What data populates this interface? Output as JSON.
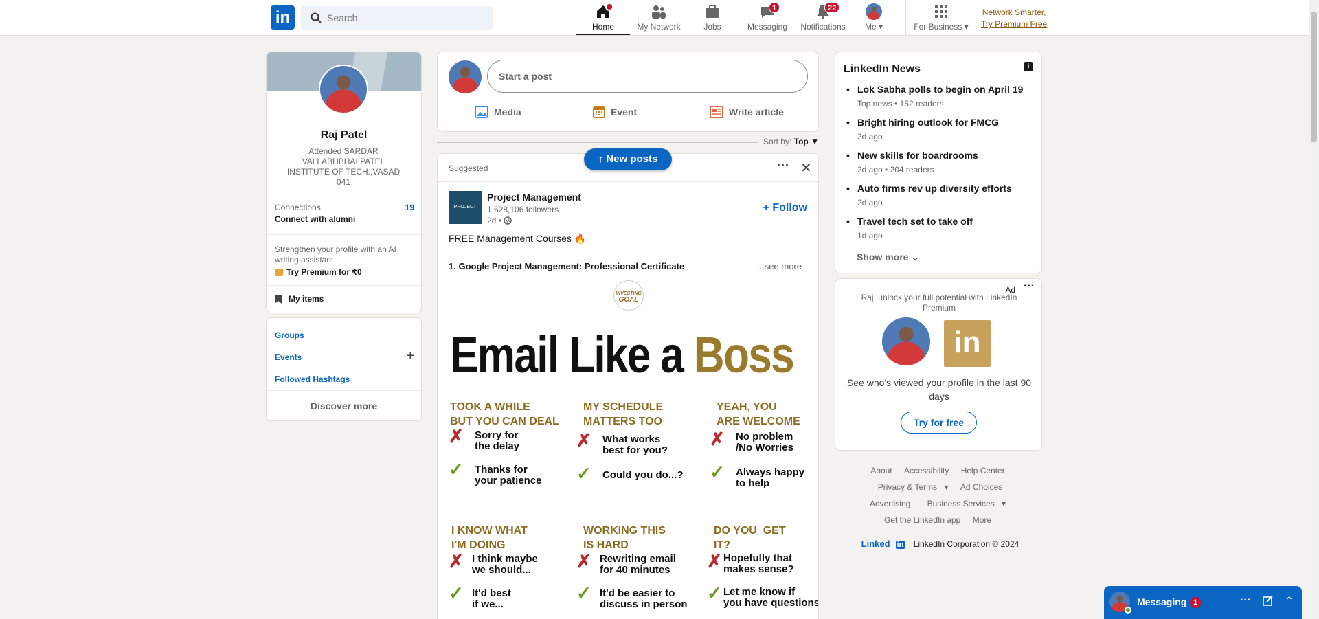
{
  "nav": {
    "logo": "in",
    "search_placeholder": "Search",
    "home": "Home",
    "network": "My Network",
    "jobs": "Jobs",
    "messaging": "Messaging",
    "messaging_count": "1",
    "notifications": "Notifications",
    "notifications_count": "22",
    "me": "Me",
    "for_business": "For Business",
    "premium_line1": "Network Smarter,",
    "premium_line2": "Try Premium Free"
  },
  "profile": {
    "name": "Raj Patel",
    "headline": "Attended SARDAR VALLABHBHAI PATEL INSTITUTE OF TECH.,VASAD 041",
    "connections_label": "Connections",
    "connections_count": "19",
    "connect_alumni": "Connect with alumni",
    "premium_prompt": "Strengthen your profile with an AI writing assistant",
    "premium_cta": "Try Premium for ₹0",
    "my_items": "My items"
  },
  "left_links": {
    "groups": "Groups",
    "events": "Events",
    "hashtags": "Followed Hashtags",
    "discover": "Discover more"
  },
  "composer": {
    "placeholder": "Start a post",
    "media": "Media",
    "event": "Event",
    "article": "Write article"
  },
  "sort": {
    "label": "Sort by:",
    "value": "Top"
  },
  "new_posts": "↑ New posts",
  "post": {
    "tag": "Suggested",
    "company": "Project Management",
    "logo_text": "PROJECT",
    "followers": "1,628,106 followers",
    "age": "2d •",
    "follow": "+ Follow",
    "line1": "FREE Management Courses 🔥",
    "line2": "1. Google Project Management: Professional Certificate",
    "see_more": "...see more",
    "image": {
      "badge_top": "INVESTING",
      "badge_bottom": "GOAL",
      "title_a": "Email Like a ",
      "title_b": "Boss",
      "cols": [
        {
          "head": "TOOK A WHILE\nBUT YOU CAN DEAL",
          "bad": "Sorry for\nthe delay",
          "good": "Thanks for\nyour patience"
        },
        {
          "head": "MY SCHEDULE\nMATTERS TOO",
          "bad": "What works\nbest for you?",
          "good": "Could you do...?"
        },
        {
          "head": "YEAH, YOU\nARE WELCOME",
          "bad": "No problem\n/No Worries",
          "good": "Always happy\nto help"
        },
        {
          "head": "I KNOW WHAT\nI'M DOING",
          "bad": "I think maybe\nwe should...",
          "good": "It'd best\nif we..."
        },
        {
          "head": "WORKING THIS\nIS HARD",
          "bad": "Rewriting email\nfor 40 minutes",
          "good": "It'd be easier to\ndiscuss in person"
        },
        {
          "head": "DO YOU  GET\nIT?",
          "bad": "Hopefully that\nmakes sense?",
          "good": "Let me know if\nyou have questions"
        }
      ]
    }
  },
  "news": {
    "title": "LinkedIn News",
    "items": [
      {
        "title": "Lok Sabha polls to begin on April 19",
        "meta": "Top news • 152 readers"
      },
      {
        "title": "Bright hiring outlook for FMCG",
        "meta": "2d ago"
      },
      {
        "title": "New skills for boardrooms",
        "meta": "2d ago • 204 readers"
      },
      {
        "title": "Auto firms rev up diversity efforts",
        "meta": "2d ago"
      },
      {
        "title": "Travel tech set to take off",
        "meta": "1d ago"
      }
    ],
    "show_more": "Show more"
  },
  "ad": {
    "label": "Ad",
    "promo": "Raj, unlock your full potential with LinkedIn Premium",
    "body": "See who's viewed your profile in the last 90 days",
    "cta": "Try for free"
  },
  "footer": {
    "about": "About",
    "accessibility": "Accessibility",
    "help": "Help Center",
    "privacy": "Privacy & Terms",
    "adchoices": "Ad Choices",
    "advertising": "Advertising",
    "business": "Business Services",
    "app": "Get the LinkedIn app",
    "more": "More",
    "brand": "Linked",
    "copyright": "LinkedIn Corporation © 2024"
  },
  "messaging_bar": {
    "label": "Messaging",
    "count": "1"
  },
  "colors": {
    "brand": "#0a66c2",
    "badge": "#cb112d",
    "premium": "#915907"
  }
}
